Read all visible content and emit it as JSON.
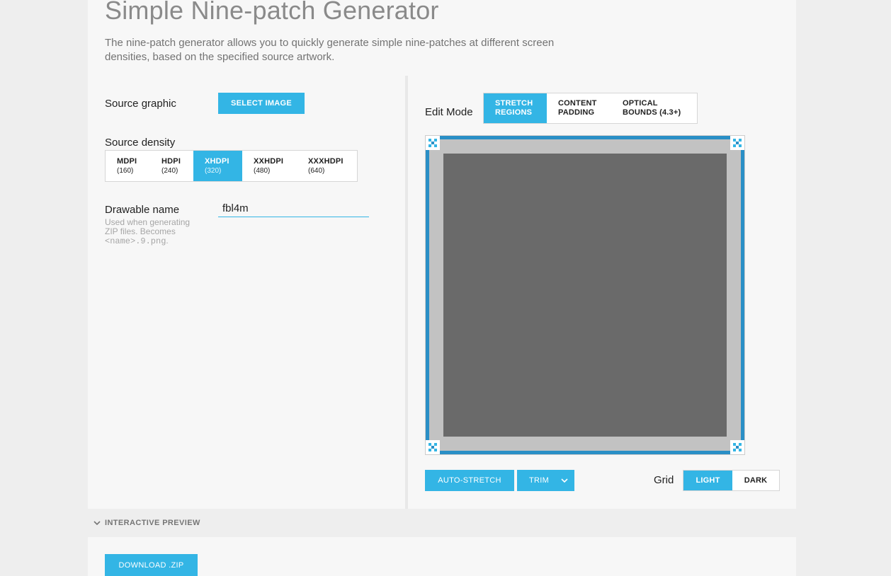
{
  "page": {
    "title": "Simple Nine-patch Generator",
    "description": "The nine-patch generator allows you to quickly generate simple nine-patches at different screen densities, based on the specified source artwork."
  },
  "source_graphic": {
    "label": "Source graphic",
    "button_label": "SELECT IMAGE"
  },
  "source_density": {
    "label": "Source density",
    "options": [
      {
        "name": "MDPI",
        "value": "(160)",
        "selected": false
      },
      {
        "name": "HDPI",
        "value": "(240)",
        "selected": false
      },
      {
        "name": "XHDPI",
        "value": "(320)",
        "selected": true
      },
      {
        "name": "XXHDPI",
        "value": "(480)",
        "selected": false
      },
      {
        "name": "XXXHDPI",
        "value": "(640)",
        "selected": false
      }
    ]
  },
  "drawable_name": {
    "label": "Drawable name",
    "value": "fbl4m",
    "hint_prefix": "Used when generating ZIP files. Becomes",
    "hint_code": "<name>.9.png",
    "hint_suffix": "."
  },
  "edit_mode": {
    "label": "Edit Mode",
    "options": [
      {
        "line1": "STRETCH",
        "line2": "REGIONS",
        "selected": true
      },
      {
        "line1": "CONTENT",
        "line2": "PADDING",
        "selected": false
      },
      {
        "line1": "OPTICAL",
        "line2": "BOUNDS (4.3+)",
        "selected": false
      }
    ]
  },
  "actions": {
    "auto_stretch": "AUTO-STRETCH",
    "trim": "TRIM"
  },
  "grid": {
    "label": "Grid",
    "options": [
      {
        "label": "LIGHT",
        "selected": true
      },
      {
        "label": "DARK",
        "selected": false
      }
    ]
  },
  "preview": {
    "label": "INTERACTIVE PREVIEW"
  },
  "download": {
    "label": "DOWNLOAD .ZIP"
  },
  "colors": {
    "accent": "#33b5e5",
    "canvas_border": "#2a8fc6",
    "canvas_fill": "#6a6a6a",
    "canvas_edge": "#c2c2c2"
  }
}
